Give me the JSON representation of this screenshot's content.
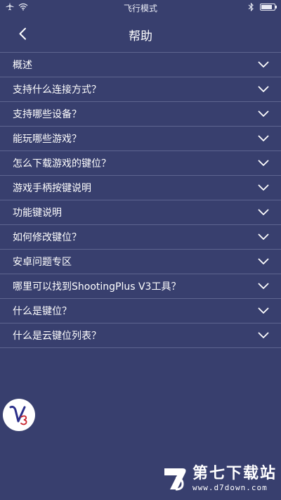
{
  "status_bar": {
    "center_text": "飞行模式",
    "battery_level": 0.85
  },
  "header": {
    "title": "帮助",
    "back_icon": "chevron-left-icon"
  },
  "faq": {
    "items": [
      {
        "label": "概述"
      },
      {
        "label": "支持什么连接方式？"
      },
      {
        "label": "支持哪些设备？"
      },
      {
        "label": "能玩哪些游戏？"
      },
      {
        "label": "怎么下载游戏的键位？"
      },
      {
        "label": "游戏手柄按键说明"
      },
      {
        "label": "功能键说明"
      },
      {
        "label": "如何修改键位？"
      },
      {
        "label": "安卓问题专区"
      },
      {
        "label": "哪里可以找到ShootingPlus V3工具？"
      },
      {
        "label": "什么是键位？"
      },
      {
        "label": "什么是云键位列表？"
      }
    ],
    "expand_icon": "chevron-down-icon"
  },
  "floating_button": {
    "logo_text": "V3"
  },
  "watermark": {
    "name": "第七下载站",
    "url": "www.d7down.com"
  },
  "colors": {
    "background": "#383f6e",
    "divider": "#5e6590",
    "text": "#ffffff"
  }
}
